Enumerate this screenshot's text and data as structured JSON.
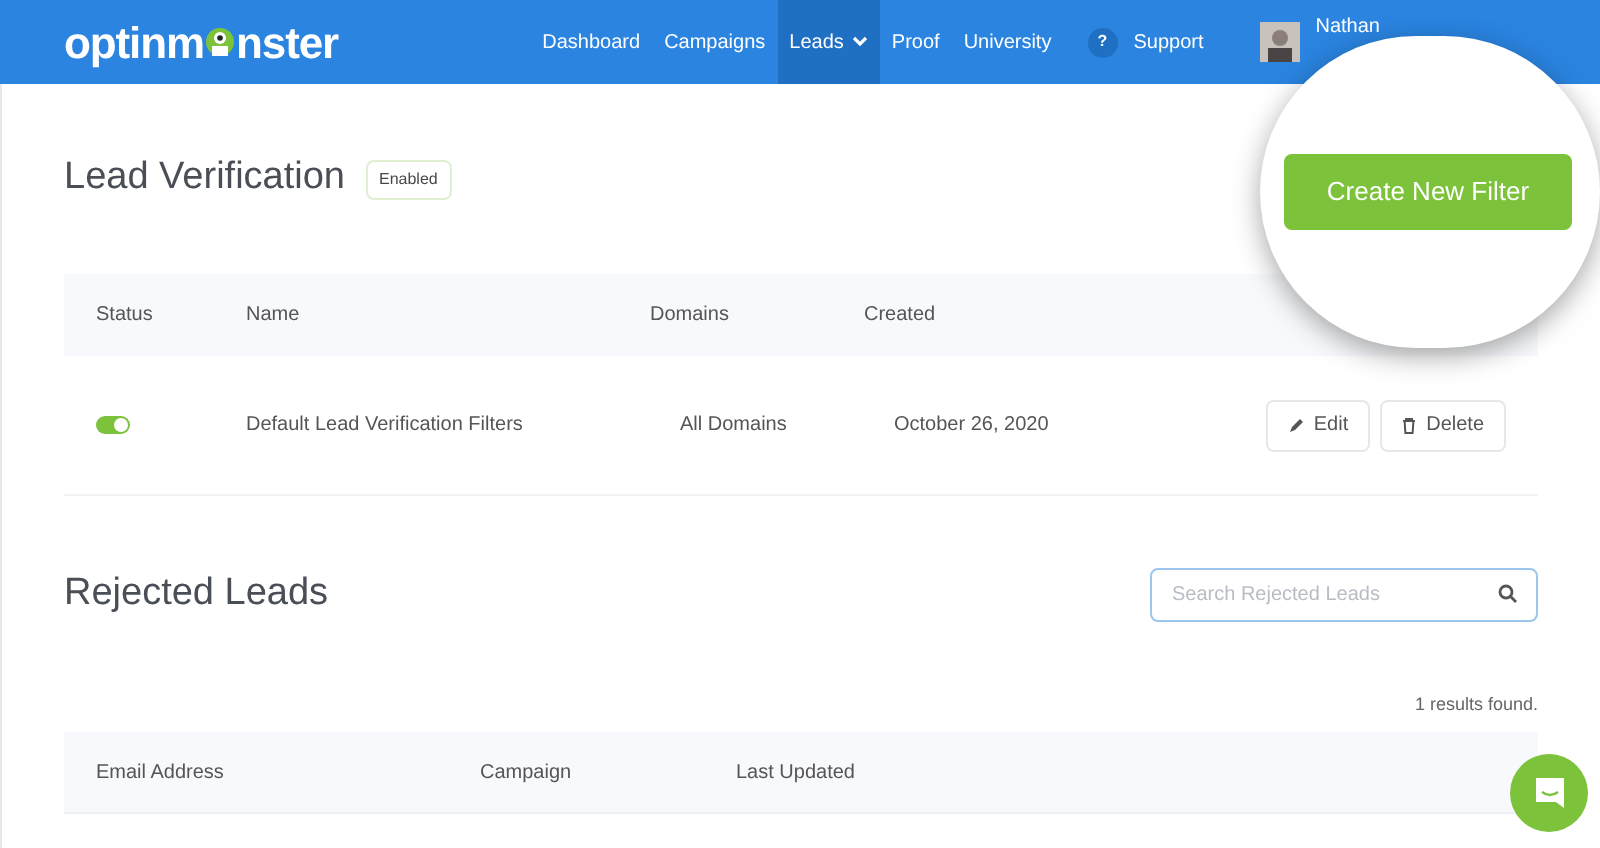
{
  "nav": {
    "logo": [
      "optinm",
      "nster"
    ],
    "items": [
      {
        "label": "Dashboard",
        "selected": false
      },
      {
        "label": "Campaigns",
        "selected": false
      },
      {
        "label": "Leads",
        "selected": true,
        "dropdown": true
      },
      {
        "label": "Proof",
        "selected": false
      },
      {
        "label": "University",
        "selected": false
      }
    ],
    "support": {
      "icon": "?",
      "label": "Support"
    },
    "user": {
      "name": "Nathan"
    }
  },
  "lead_verification": {
    "title": "Lead Verification",
    "badge": "Enabled",
    "create_button": "Create New Filter",
    "columns": [
      "Status",
      "Name",
      "Domains",
      "Created"
    ],
    "rows": [
      {
        "on": true,
        "name": "Default Lead Verification Filters",
        "domains": "All Domains",
        "created": "October 26, 2020",
        "actions": [
          "Edit",
          "Delete"
        ]
      }
    ]
  },
  "rejected_leads": {
    "title": "Rejected Leads",
    "search": {
      "placeholder": "Search Rejected Leads"
    },
    "results": "1 results found.",
    "columns": [
      "Email Address",
      "Campaign",
      "Last Updated"
    ]
  }
}
